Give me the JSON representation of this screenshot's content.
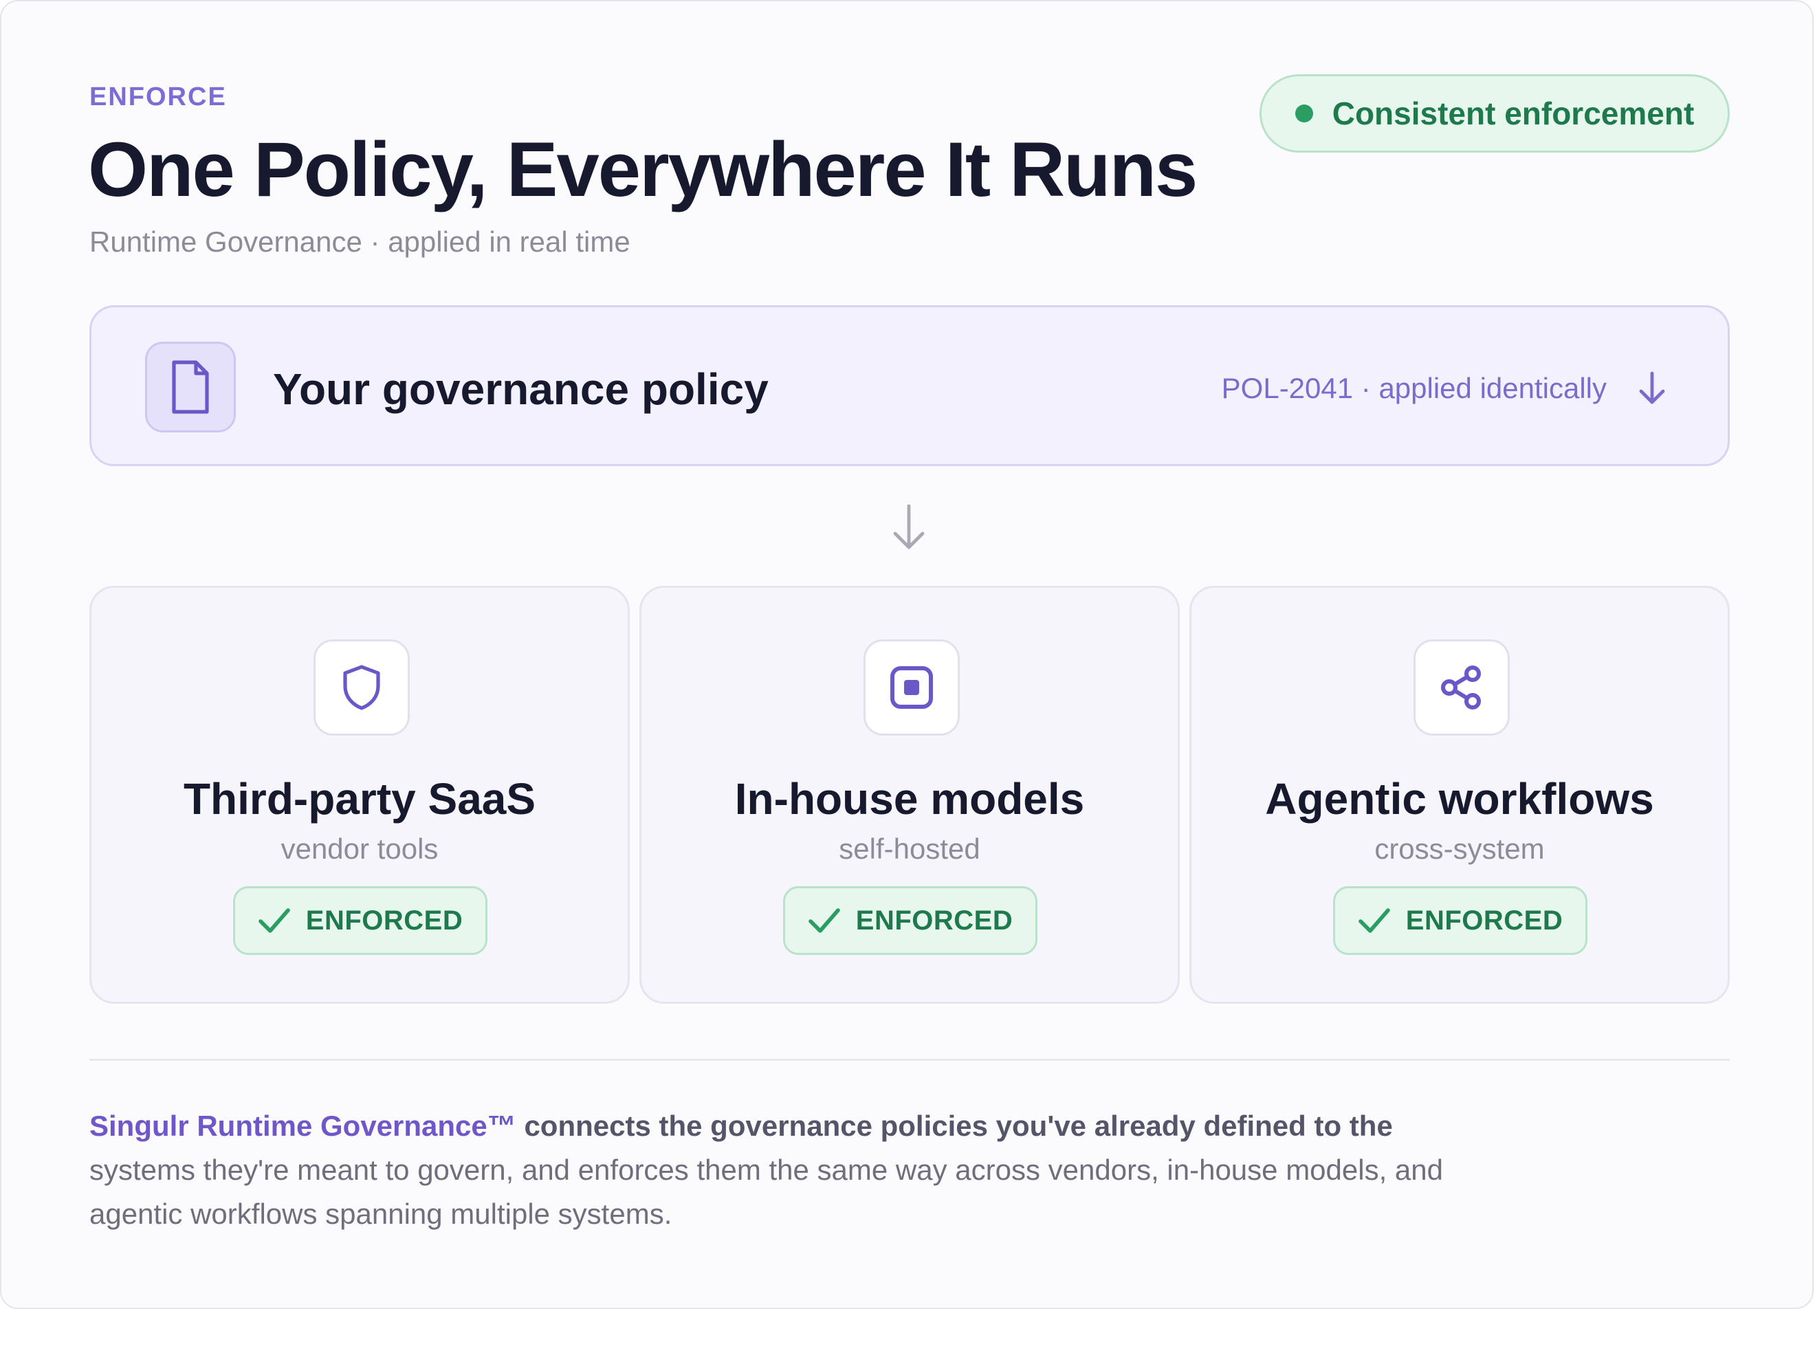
{
  "header": {
    "eyebrow": "ENFORCE",
    "title": "One Policy, Everywhere It Runs",
    "subtitle": "Runtime Governance · applied in real time",
    "status_badge": "Consistent enforcement"
  },
  "policy": {
    "icon": "document-icon",
    "title": "Your governance policy",
    "meta": "POL-2041 · applied identically",
    "arrow_icon": "arrow-down-icon"
  },
  "targets": [
    {
      "icon": "shield-icon",
      "title": "Third-party SaaS",
      "subtitle": "vendor tools",
      "status": "ENFORCED"
    },
    {
      "icon": "chip-icon",
      "title": "In-house models",
      "subtitle": "self-hosted",
      "status": "ENFORCED"
    },
    {
      "icon": "share-nodes-icon",
      "title": "Agentic workflows",
      "subtitle": "cross-system",
      "status": "ENFORCED"
    }
  ],
  "footer": {
    "brand": "Singulr Runtime Governance™",
    "lead": "connects the governance policies you've already defined to the",
    "body": "systems they're meant to govern, and enforces them the same way across vendors, in-house models, and agentic workflows spanning multiple systems."
  },
  "colors": {
    "accent": "#7f6bd4",
    "success": "#1e7a4c",
    "success_bg": "#e8f7ee",
    "title": "#171a2e"
  }
}
